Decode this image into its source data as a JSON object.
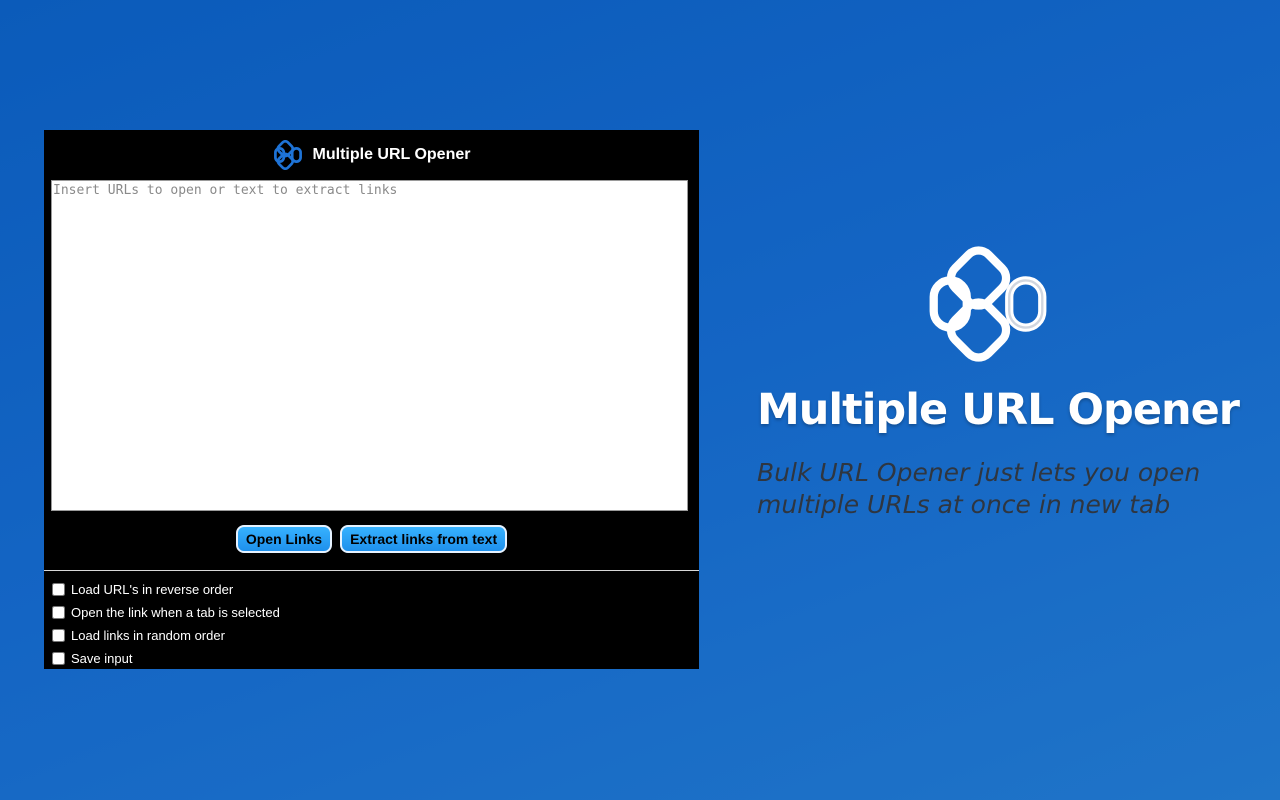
{
  "popup": {
    "title": "Multiple URL Opener",
    "logo_icon": "chain-link-icon",
    "input": {
      "value": "",
      "placeholder": "Insert URLs to open or text to extract links"
    },
    "buttons": {
      "open_label": "Open Links",
      "extract_label": "Extract links from text"
    },
    "options": [
      {
        "label": "Load URL's in reverse order",
        "checked": false
      },
      {
        "label": "Open the link when a tab is selected",
        "checked": false
      },
      {
        "label": "Load links in random order",
        "checked": false
      },
      {
        "label": "Save input",
        "checked": false
      }
    ]
  },
  "promo": {
    "logo_icon": "chain-link-icon",
    "title": "Multiple URL Opener",
    "subtitle": "Bulk URL Opener  just lets you open multiple URLs at once in new tab"
  },
  "colors": {
    "background": "#1465c4",
    "button": "#1e90ec",
    "popup_background": "#000000"
  }
}
